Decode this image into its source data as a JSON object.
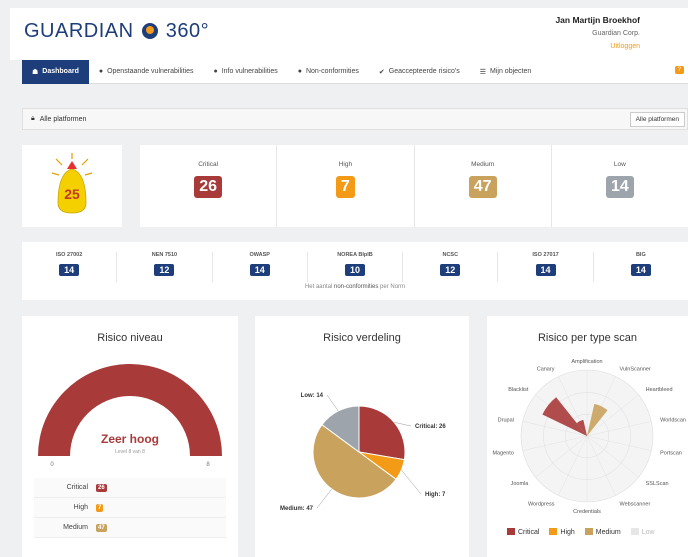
{
  "header": {
    "logo_text": "GUARDIAN",
    "logo_num": "360°",
    "user_name": "Jan Martijn Broekhof",
    "company": "Guardian Corp.",
    "logout": "Uitloggen"
  },
  "nav": {
    "items": [
      {
        "label": "Dashboard",
        "icon": "dashboard-icon"
      },
      {
        "label": "Openstaande vulnerabilities",
        "icon": "bullet-icon"
      },
      {
        "label": "Info vulnerabilities",
        "icon": "bullet-icon"
      },
      {
        "label": "Non-conformities",
        "icon": "bullet-icon"
      },
      {
        "label": "Geaccepteerde risico's",
        "icon": "check-icon"
      },
      {
        "label": "Mijn objecten",
        "icon": "list-icon"
      }
    ]
  },
  "platform": {
    "label": "Alle platformen",
    "button": "Alle platformen"
  },
  "score": {
    "value": "25"
  },
  "counts": [
    {
      "label": "Critical",
      "value": "26",
      "color": "#a93a3a"
    },
    {
      "label": "High",
      "value": "7",
      "color": "#f39a16"
    },
    {
      "label": "Medium",
      "value": "47",
      "color": "#c9a35e"
    },
    {
      "label": "Low",
      "value": "14",
      "color": "#9ea4ab"
    }
  ],
  "norms": {
    "items": [
      {
        "label": "ISO 27002",
        "value": "14"
      },
      {
        "label": "NEN 7510",
        "value": "12"
      },
      {
        "label": "OWASP",
        "value": "14"
      },
      {
        "label": "NOREA BIpIB",
        "value": "10"
      },
      {
        "label": "NCSC",
        "value": "12"
      },
      {
        "label": "ISO 27017",
        "value": "14"
      },
      {
        "label": "BIG",
        "value": "14"
      }
    ],
    "note_pre": "Het aantal",
    "note_mid": "non-conformities",
    "note_post": "per Norm"
  },
  "risk_level": {
    "title": "Risico niveau",
    "level_text": "Zeer hoog",
    "sub_text": "Level 8 van 8",
    "level_fraction": 1.0,
    "min": "0",
    "max": "8",
    "rows": [
      {
        "label": "Critical",
        "value": "26",
        "color": "#a93a3a"
      },
      {
        "label": "High",
        "value": "7",
        "color": "#f39a16"
      },
      {
        "label": "Medium",
        "value": "47",
        "color": "#c9a35e"
      }
    ]
  },
  "chart_data": [
    {
      "type": "pie",
      "title": "Risico verdeling",
      "slices": [
        {
          "label": "Critical: 26",
          "value": 26,
          "color": "#a93a3a"
        },
        {
          "label": "High: 7",
          "value": 7,
          "color": "#f39a16"
        },
        {
          "label": "Medium: 47",
          "value": 47,
          "color": "#c9a35e"
        },
        {
          "label": "Low: 14",
          "value": 14,
          "color": "#9ea4ab"
        }
      ]
    },
    {
      "type": "polar",
      "title": "Risico per type scan",
      "categories": [
        "Amplification",
        "VulnScanner",
        "Heartbleed",
        "Worldscan",
        "Portscan",
        "SSLScan",
        "Webscanner",
        "Credentials",
        "Wordpress",
        "Joomla",
        "Magento",
        "Drupal",
        "Blacklist",
        "Canary"
      ],
      "series": [
        {
          "name": "Critical",
          "color": "#a93a3a",
          "values": [
            0,
            0,
            0,
            0,
            0,
            0,
            0,
            0,
            0,
            0,
            0,
            0,
            3,
            1
          ]
        },
        {
          "name": "High",
          "color": "#f39a16",
          "values": [
            0,
            0,
            0,
            0,
            0,
            0,
            0,
            0,
            0,
            0,
            0,
            0,
            0,
            0
          ]
        },
        {
          "name": "Medium",
          "color": "#c9a35e",
          "values": [
            0,
            2,
            0,
            0,
            0,
            0,
            0,
            0,
            0,
            0,
            0,
            0,
            0,
            0
          ]
        },
        {
          "name": "Low",
          "color": "#d9d9d9",
          "values": [
            0,
            0,
            0,
            0,
            0,
            0,
            0,
            0,
            0,
            0,
            0,
            0,
            0,
            0
          ]
        }
      ]
    }
  ]
}
